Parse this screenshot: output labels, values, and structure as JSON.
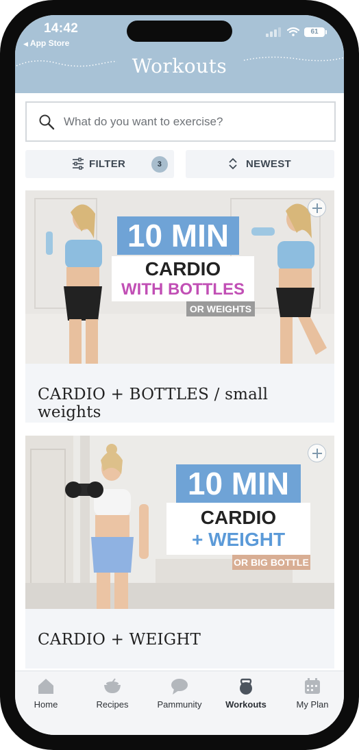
{
  "status_bar": {
    "time": "14:42",
    "back_label": "App Store",
    "battery": "61"
  },
  "header": {
    "title": "Workouts"
  },
  "search": {
    "placeholder": "What do you want to exercise?"
  },
  "toolbar": {
    "filter_label": "FILTER",
    "filter_count": "3",
    "sort_label": "NEWEST"
  },
  "workouts": [
    {
      "title": "CARDIO + BOTTLES / small weights",
      "banner_number": "10 MIN",
      "banner_line1": "CARDIO",
      "banner_line2": "WITH BOTTLES",
      "banner_tag": "OR WEIGHTS",
      "accent_color": "#c14fb5"
    },
    {
      "title": "CARDIO + WEIGHT",
      "banner_number": "10 MIN",
      "banner_line1": "CARDIO",
      "banner_line2": "+ WEIGHT",
      "banner_tag": "OR BIG BOTTLE",
      "accent_color": "#5b9ad8"
    }
  ],
  "tabbar": {
    "items": [
      {
        "label": "Home",
        "icon": "home-icon"
      },
      {
        "label": "Recipes",
        "icon": "bowl-icon"
      },
      {
        "label": "Pammunity",
        "icon": "chat-bubble-icon"
      },
      {
        "label": "Workouts",
        "icon": "kettlebell-icon",
        "active": true
      },
      {
        "label": "My Plan",
        "icon": "calendar-icon"
      }
    ]
  },
  "colors": {
    "header_bg": "#a8c2d6",
    "banner_blue": "#6fa3d6",
    "card_bg": "#f3f5f8"
  }
}
